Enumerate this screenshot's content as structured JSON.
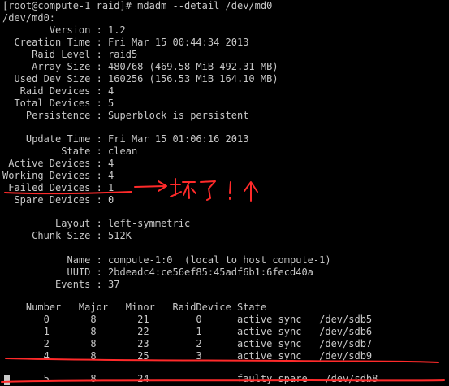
{
  "terminal": {
    "background": "#000000",
    "text_color": "#c8c8c8",
    "lines": [
      "[root@compute-1 raid]# mdadm --detail /dev/md0",
      "/dev/md0:",
      "        Version : 1.2",
      "  Creation Time : Fri Mar 15 00:44:34 2013",
      "     Raid Level : raid5",
      "     Array Size : 480768 (469.58 MiB 492.31 MB)",
      "  Used Dev Size : 160256 (156.53 MiB 164.10 MB)",
      "   Raid Devices : 4",
      "  Total Devices : 5",
      "    Persistence : Superblock is persistent",
      "",
      "    Update Time : Fri Mar 15 01:06:16 2013",
      "          State : clean",
      " Active Devices : 4",
      "Working Devices : 4",
      " Failed Devices : 1",
      "  Spare Devices : 0",
      "",
      "         Layout : left-symmetric",
      "     Chunk Size : 512K",
      "",
      "           Name : compute-1:0  (local to host compute-1)",
      "           UUID : 2bdeadc4:ce56ef85:45adf6b1:6fecd40a",
      "         Events : 37",
      "",
      "    Number   Major   Minor   RaidDevice State",
      "       0       8       21        0      active sync   /dev/sdb5",
      "       1       8       22        1      active sync   /dev/sdb6",
      "       2       8       23        2      active sync   /dev/sdb7",
      "       4       8       25        3      active sync   /dev/sdb9",
      "",
      "       5       8       24        -      faulty spare   /dev/sdb8"
    ]
  },
  "annotation": {
    "color": "#ff2a2a",
    "handwritten_note": "-->坏了! ↑"
  }
}
